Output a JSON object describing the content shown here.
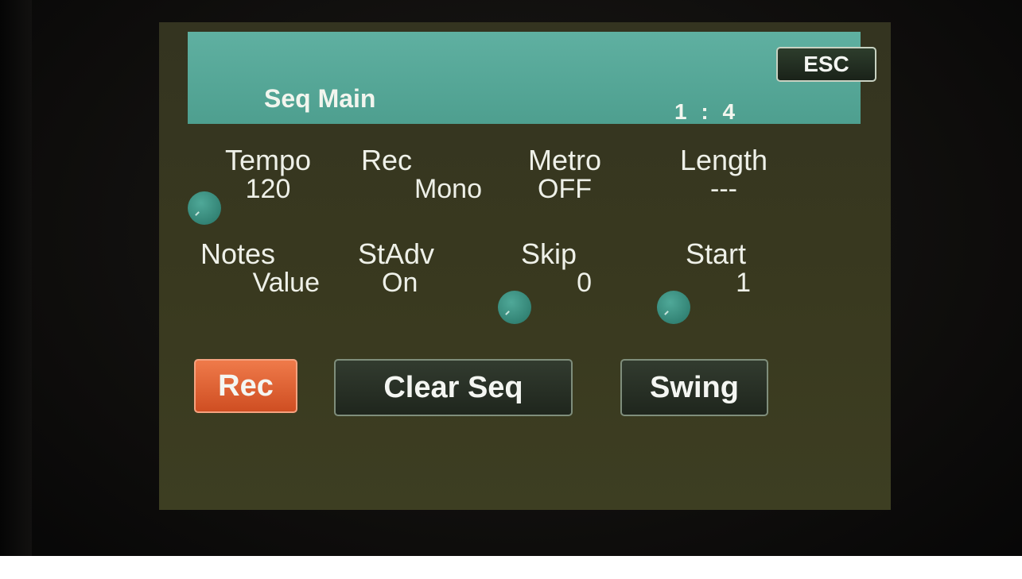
{
  "header": {
    "title": "Seq Main",
    "position": "1 : 4",
    "esc_label": "ESC"
  },
  "params": [
    {
      "label": "Tempo",
      "value": "120"
    },
    {
      "label": "Rec",
      "value": "Mono"
    },
    {
      "label": "Metro",
      "value": "OFF"
    },
    {
      "label": "Length",
      "value": "---"
    },
    {
      "label": "Notes",
      "value": "Value"
    },
    {
      "label": "StAdv",
      "value": "On"
    },
    {
      "label": "Skip",
      "value": "0"
    },
    {
      "label": "Start",
      "value": "1"
    }
  ],
  "buttons": {
    "rec": "Rec",
    "clear_seq": "Clear Seq",
    "swing": "Swing"
  },
  "colors": {
    "header": "#56a898",
    "screen_bg": "#383820",
    "rec_active": "#e0602f",
    "knob": "#3f9585"
  }
}
